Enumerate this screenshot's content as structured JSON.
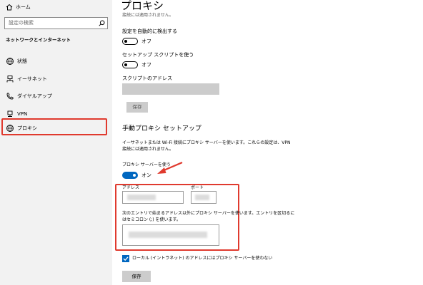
{
  "sidebar": {
    "home_label": "ホーム",
    "search_placeholder": "設定の検索",
    "section_title": "ネットワークとインターネット",
    "items": [
      {
        "icon": "globe-status-icon",
        "label": "状態"
      },
      {
        "icon": "ethernet-icon",
        "label": "イーサネット"
      },
      {
        "icon": "dialup-icon",
        "label": "ダイヤルアップ"
      },
      {
        "icon": "vpn-icon",
        "label": "VPN"
      },
      {
        "icon": "globe-icon",
        "label": "プロキシ"
      }
    ]
  },
  "main": {
    "title": "プロキシ",
    "cut_text": "接続には適用されません。",
    "auto_detect": {
      "label": "設定を自動的に検出する",
      "state": "オフ"
    },
    "setup_script": {
      "label": "セットアップ スクリプトを使う",
      "state": "オフ"
    },
    "script_address_label": "スクリプトのアドレス",
    "save_label": "保存",
    "manual": {
      "heading": "手動プロキシ セットアップ",
      "desc_line1": "イーサネットまたは Wi-Fi 接続にプロキシ サーバーを使います。これらの設定は、VPN",
      "desc_line2": "接続には適用されません。",
      "use_proxy_label": "プロキシ サーバーを使う",
      "use_proxy_state": "オン",
      "address_label": "アドレス",
      "port_label": "ポート",
      "exceptions_line1": "次のエントリで始まるアドレス以外にプロキシ サーバーを使います。エントリを区切るに",
      "exceptions_line2": "はセミコロン (;) を使います。",
      "local_bypass_label": "ローカル (イントラネット) のアドレスにはプロキシ サーバーを使わない",
      "local_bypass_checked": true,
      "save_label": "保存"
    }
  },
  "colors": {
    "accent": "#0067c0",
    "highlight": "#e03a2e",
    "sidebar_bg": "#f2f2f2"
  }
}
